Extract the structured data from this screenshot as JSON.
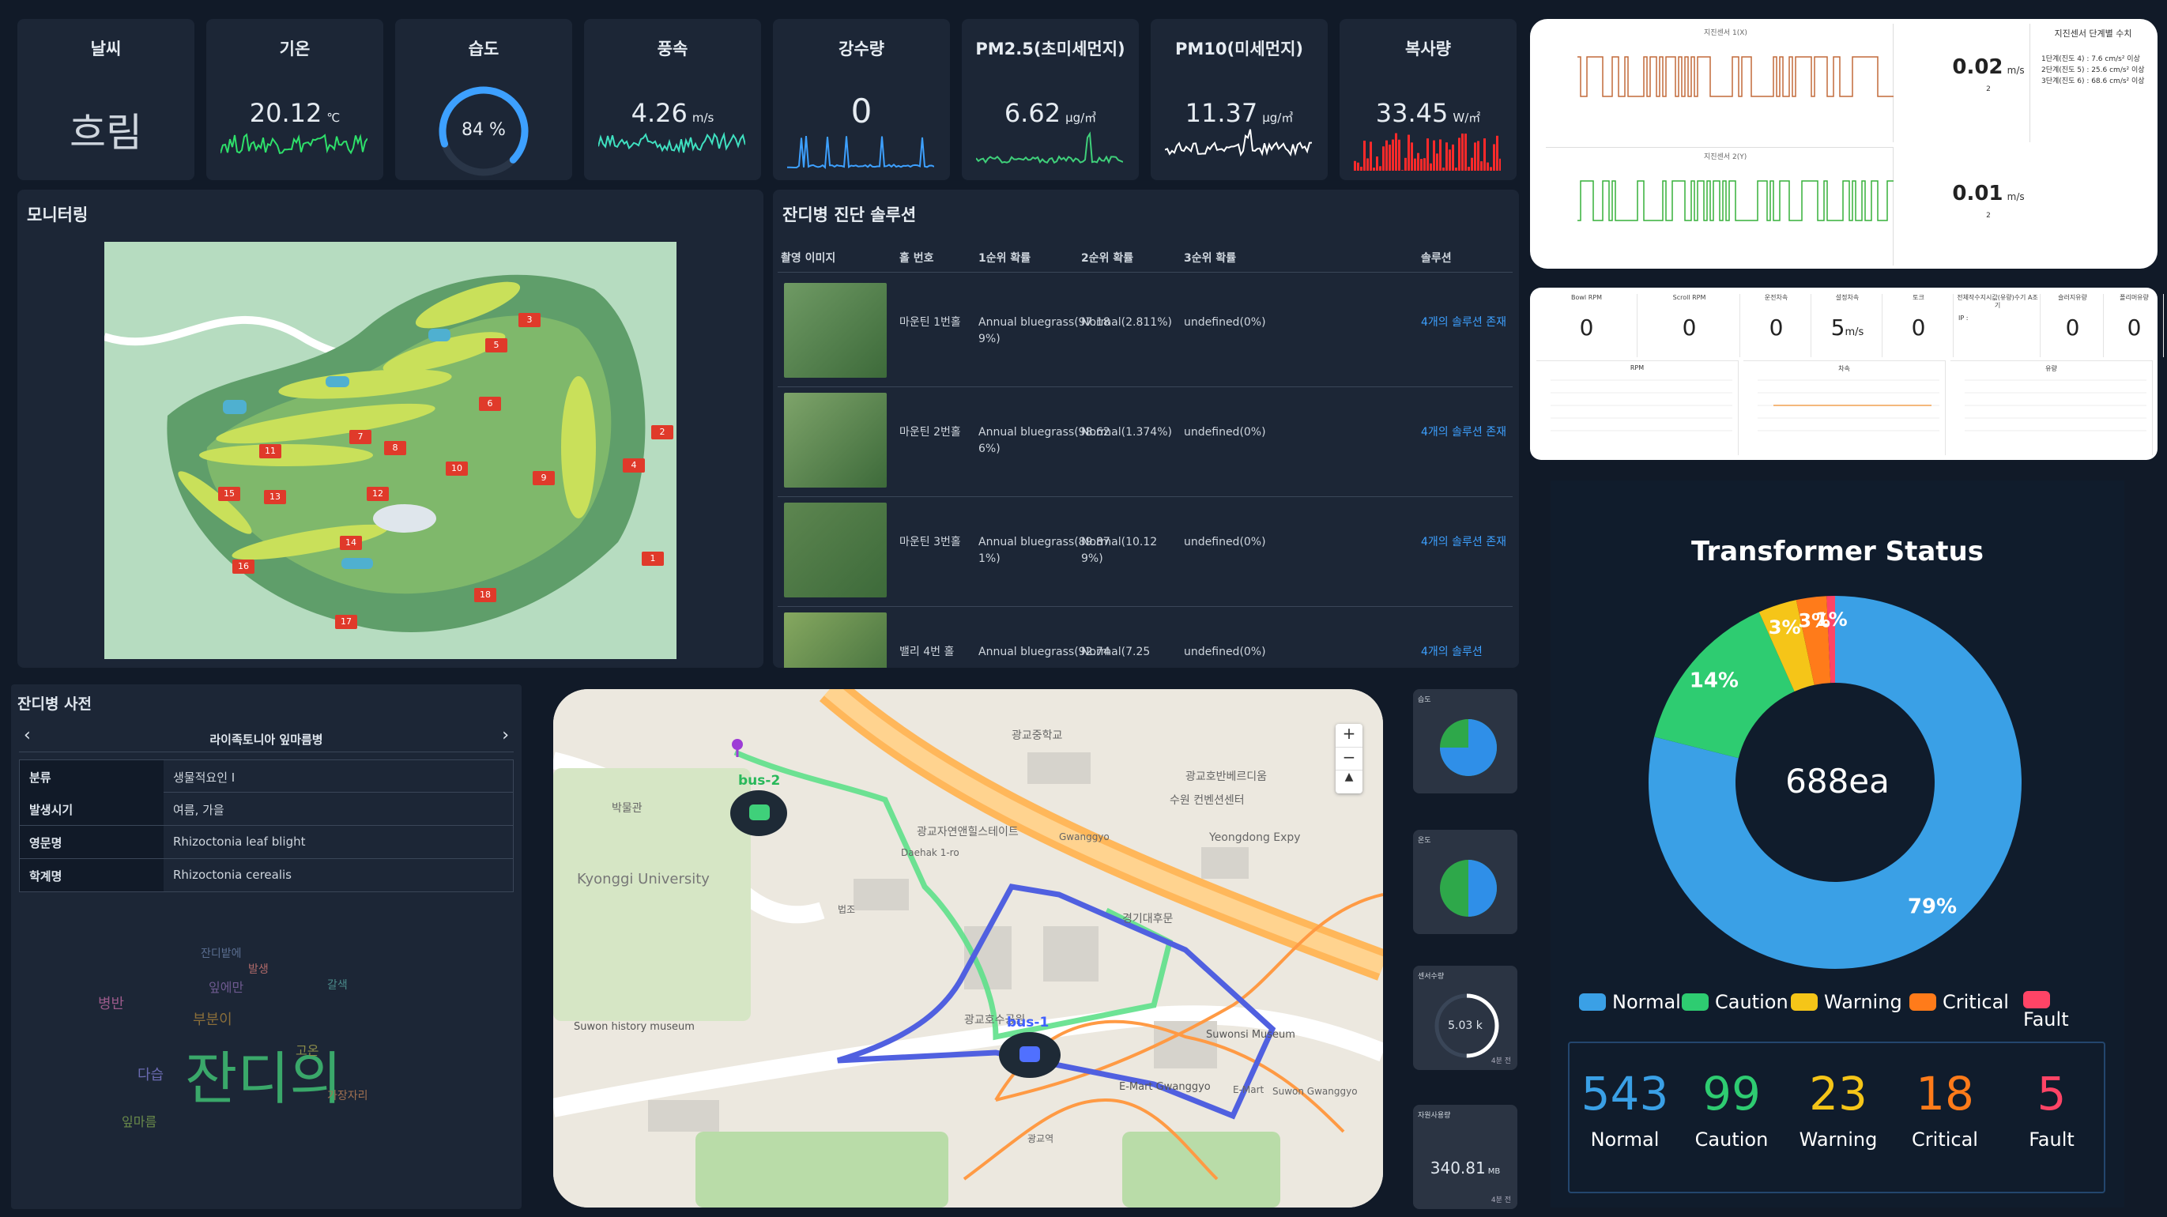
{
  "colors": {
    "bg": "#111a28",
    "card": "#1c2636",
    "accent": "#3da0ff",
    "green": "#36d07a",
    "red": "#ff3a3a",
    "white": "#ffffff"
  },
  "kpis": [
    {
      "title": "날씨",
      "value": "흐림",
      "unit": "",
      "spark": "none"
    },
    {
      "title": "기온",
      "value": "20.12",
      "unit": "℃",
      "spark": "green"
    },
    {
      "title": "습도",
      "value": "84 %",
      "unit": "",
      "spark": "gauge",
      "level": 0.84
    },
    {
      "title": "풍속",
      "value": "4.26",
      "unit": "m/s",
      "spark": "teal"
    },
    {
      "title": "강수량",
      "value": "0",
      "unit": "",
      "spark": "blue"
    },
    {
      "title": "PM2.5(초미세먼지)",
      "value": "6.62",
      "unit": "μg/㎥",
      "spark": "green2"
    },
    {
      "title": "PM10(미세먼지)",
      "value": "11.37",
      "unit": "μg/㎥",
      "spark": "white"
    },
    {
      "title": "복사량",
      "value": "33.45",
      "unit": "W/㎡",
      "spark": "red"
    }
  ],
  "monitoring": {
    "title": "모니터링",
    "holes": [
      "1",
      "2",
      "3",
      "4",
      "5",
      "6",
      "7",
      "8",
      "9",
      "10",
      "11",
      "12",
      "13",
      "14",
      "15",
      "16",
      "17",
      "18"
    ]
  },
  "diagnosis": {
    "title": "잔디병 진단 솔루션",
    "headers": [
      "촬영 이미지",
      "홀 번호",
      "1순위 확률",
      "2순위 확률",
      "3순위 확률",
      "솔루션"
    ],
    "rows": [
      {
        "hole": "마운틴 1번홀",
        "p1": "Annual bluegrass(97.189%)",
        "p2": "Normal(2.811%)",
        "p3": "undefined(0%)",
        "sol": "4개의 솔루션 존재"
      },
      {
        "hole": "마운틴 2번홀",
        "p1": "Annual bluegrass(98.626%)",
        "p2": "Normal(1.374%)",
        "p3": "undefined(0%)",
        "sol": "4개의 솔루션 존재"
      },
      {
        "hole": "마운틴 3번홀",
        "p1": "Annual bluegrass(89.871%)",
        "p2": "Normal(10.129%)",
        "p3": "undefined(0%)",
        "sol": "4개의 솔루션 존재"
      },
      {
        "hole": "밸리 4번 홀",
        "p1": "Annual bluegrass(92.74",
        "p2": "Normal(7.25",
        "p3": "undefined(0%)",
        "sol": "4개의 솔루션"
      }
    ]
  },
  "dictionary": {
    "title": "잔디병 사전",
    "disease": "라이족토니아 잎마름병",
    "prev": "‹",
    "next": "›",
    "rows": [
      {
        "k": "분류",
        "v": "생물적요인 I"
      },
      {
        "k": "발생시기",
        "v": "여름, 가을"
      },
      {
        "k": "영문명",
        "v": "Rhizoctonia leaf blight"
      },
      {
        "k": "학계명",
        "v": "Rhizoctonia cerealis"
      }
    ],
    "wordcloud_main": "잔디의",
    "words": [
      "잔디밭에",
      "잎에만",
      "부분이",
      "가장자리",
      "잎마름",
      "병반",
      "갈색",
      "고온",
      "다습",
      "발생"
    ]
  },
  "map": {
    "buses": [
      {
        "label": "bus-2"
      },
      {
        "label": "bus-1"
      }
    ],
    "places": [
      "Kyonggi University",
      "Suwon history museum",
      "Suwonsi Museum",
      "E-Mart Gwanggyo",
      "Daehak 1-ro",
      "Yeongdong Expy",
      "광교중학교",
      "광교호수공원",
      "광교자연앤힐스테이트",
      "박물관",
      "광교호반베르디움",
      "수원 컨벤션센터",
      "경기대후문",
      "법조",
      "광교역",
      "E-Mart",
      "Suwon Gwanggyo",
      "Gwanggyo"
    ],
    "zoom_in": "+",
    "zoom_out": "−",
    "compass": "▲"
  },
  "seismic": {
    "val1": "0.02",
    "val2": "0.01",
    "unit": "m/s",
    "title1": "지진센서 1(X)",
    "title2": "지진센서 2(Y)",
    "thr_title": "지진센서 단계별 수치",
    "thresholds": [
      "1단계(진도 4) : 7.6 cm/s² 이상",
      "2단계(진도 5) : 25.6 cm/s² 이상",
      "3단계(진도 6) : 68.6 cm/s² 이상"
    ],
    "sub": "2"
  },
  "machine": {
    "labels": [
      "Bowl RPM",
      "Scroll RPM",
      "운전차속",
      "설정차속",
      "토크",
      "전체작수지시값(유량)수기 A조기",
      "슬러지유량",
      "폴리머유량"
    ],
    "values": [
      "0",
      "0",
      "0",
      "5",
      "0",
      "",
      "0",
      "0"
    ],
    "unit4": "m/s",
    "ip": "IP :",
    "chart_titles": [
      "RPM",
      "차속",
      "유량"
    ]
  },
  "transformer": {
    "title": "Transformer Status",
    "total": "688ea",
    "legend": [
      "Normal",
      "Caution",
      "Warning",
      "Critical",
      "Fault"
    ],
    "counts": [
      "543",
      "99",
      "23",
      "18",
      "5"
    ],
    "pct_labels": [
      "79%",
      "14%",
      "3%",
      "3%",
      "1%"
    ]
  },
  "chart_data": {
    "type": "pie",
    "categories": [
      "Normal",
      "Caution",
      "Warning",
      "Critical",
      "Fault"
    ],
    "values": [
      543,
      99,
      23,
      18,
      5
    ],
    "colors": [
      "#3aa0e6",
      "#2ecc71",
      "#f5c518",
      "#ff7b1a",
      "#ff4466"
    ]
  },
  "side_minis": [
    {
      "title": "습도",
      "kind": "pie",
      "frac": 0.75
    },
    {
      "title": "온도",
      "kind": "pie",
      "frac": 0.5
    },
    {
      "title": "센서수량",
      "kind": "gauge",
      "value": "5.03 k",
      "note": "4분 전",
      "level": 0.5
    },
    {
      "title": "자원사용량",
      "kind": "text",
      "value": "340.81",
      "unit": "MB",
      "note": "4분 전"
    }
  ]
}
